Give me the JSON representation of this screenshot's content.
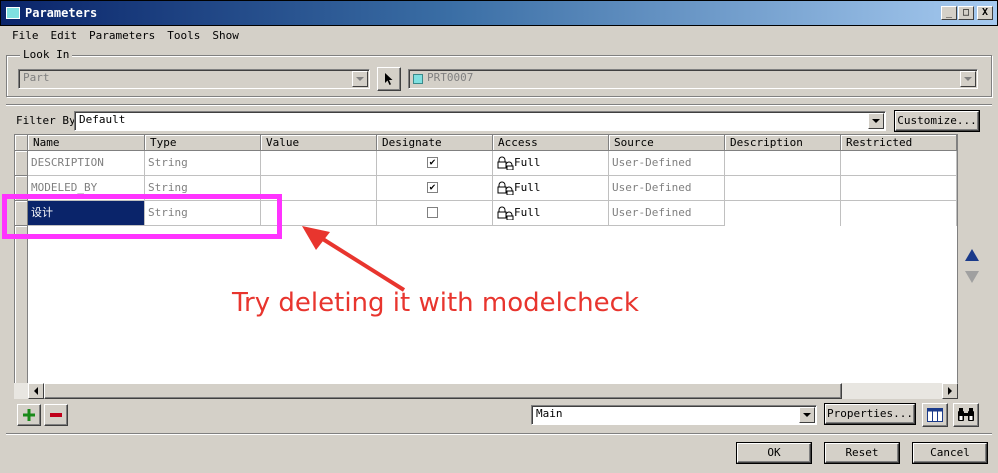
{
  "window": {
    "title": "Parameters",
    "controls": [
      "_",
      "□",
      "X"
    ]
  },
  "menubar": {
    "items": [
      "File",
      "Edit",
      "Parameters",
      "Tools",
      "Show"
    ]
  },
  "look_in": {
    "label": "Look In",
    "type_value": "Part",
    "object_value": "PRT0007"
  },
  "filter": {
    "label": "Filter By",
    "value": "Default",
    "customize_label": "Customize..."
  },
  "table": {
    "columns": [
      "Name",
      "Type",
      "Value",
      "Designate",
      "Access",
      "Source",
      "Description",
      "Restricted"
    ],
    "rows": [
      {
        "name": "DESCRIPTION",
        "type": "String",
        "value": "",
        "designate": true,
        "access": "Full",
        "source": "User-Defined",
        "description": "",
        "restricted": ""
      },
      {
        "name": "MODELED_BY",
        "type": "String",
        "value": "",
        "designate": true,
        "access": "Full",
        "source": "User-Defined",
        "description": "",
        "restricted": ""
      },
      {
        "name": "设计",
        "type": "String",
        "value": "",
        "designate": false,
        "access": "Full",
        "source": "User-Defined",
        "description": "",
        "restricted": ""
      }
    ]
  },
  "bottom": {
    "main_value": "Main",
    "properties_label": "Properties...",
    "ok_label": "OK",
    "reset_label": "Reset",
    "cancel_label": "Cancel"
  },
  "annotation": {
    "text": "Try deleting it with modelcheck",
    "color": "#e8352e",
    "highlight_color": "#ff33ff"
  },
  "colors": {
    "selection": "#0a246a",
    "window_bg": "#d4d0c8",
    "add_icon": "#1a8a1a",
    "remove_icon": "#c0001a",
    "arrow_up": "#1a3a8a"
  }
}
